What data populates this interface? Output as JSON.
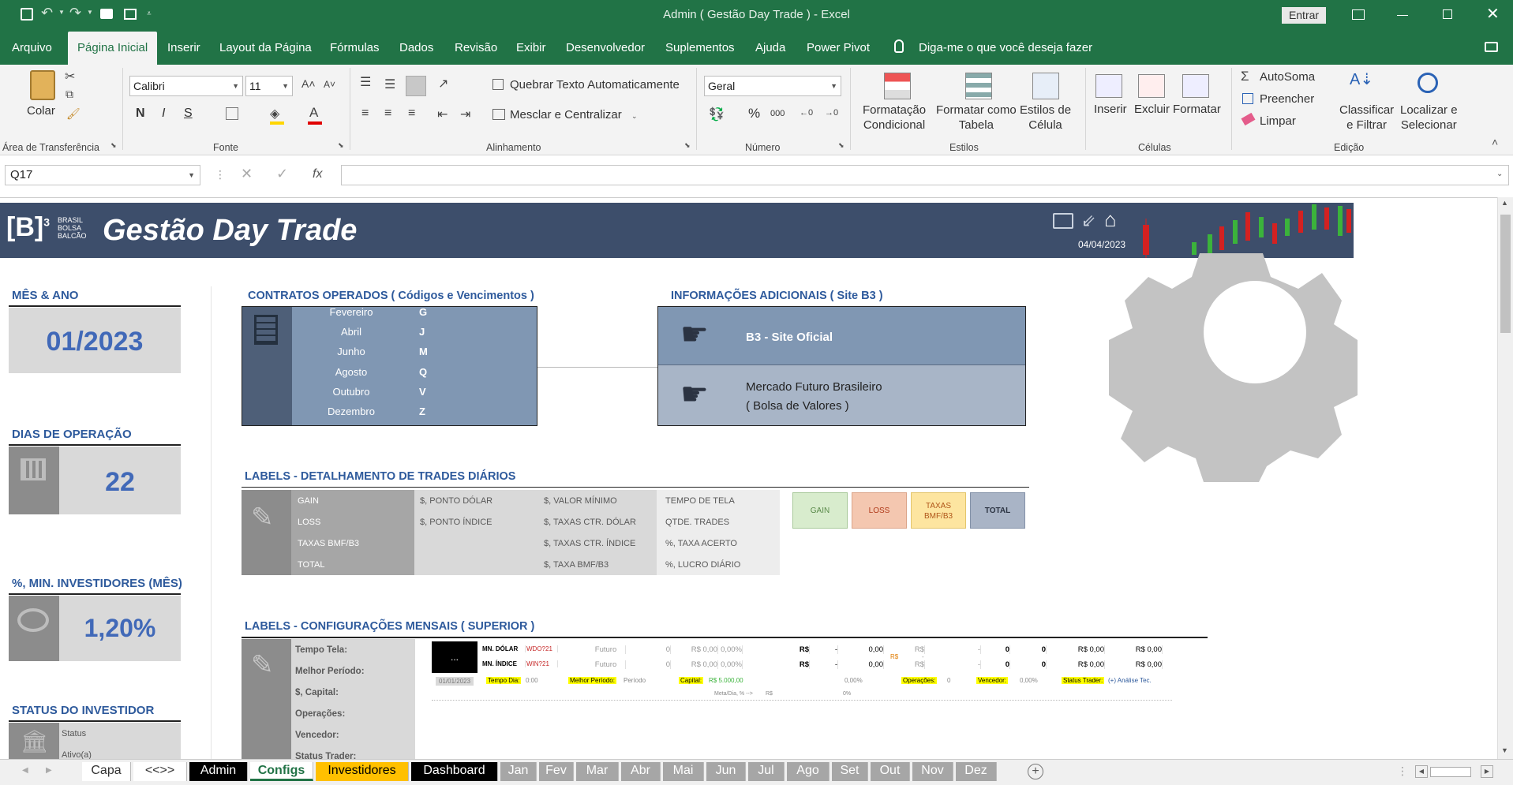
{
  "window": {
    "title": "Admin ( Gestão Day Trade )  -  Excel",
    "signin": "Entrar"
  },
  "menu": [
    "Arquivo",
    "Página Inicial",
    "Inserir",
    "Layout da Página",
    "Fórmulas",
    "Dados",
    "Revisão",
    "Exibir",
    "Desenvolvedor",
    "Suplementos",
    "Ajuda",
    "Power Pivot",
    "Diga-me o que você deseja fazer"
  ],
  "ribbon": {
    "paste": "Colar",
    "clipboard": "Área de Transferência",
    "font_name": "Calibri",
    "font_size": "11",
    "bold": "N",
    "italic": "I",
    "underline": "S",
    "font_group": "Fonte",
    "wrap": "Quebrar Texto Automaticamente",
    "merge": "Mesclar e Centralizar",
    "align_group": "Alinhamento",
    "number_format": "Geral",
    "percent": "%",
    "thousands": "000",
    "number_group": "Número",
    "cond_fmt_1": "Formatação",
    "cond_fmt_2": "Condicional",
    "fmt_table_1": "Formatar como",
    "fmt_table_2": "Tabela",
    "cell_styles_1": "Estilos de",
    "cell_styles_2": "Célula",
    "styles_group": "Estilos",
    "insert": "Inserir",
    "delete": "Excluir",
    "format": "Formatar",
    "cells_group": "Células",
    "autosum": "AutoSoma",
    "fill": "Preencher",
    "clear": "Limpar",
    "sort_1": "Classificar",
    "sort_2": "e Filtrar",
    "find_1": "Localizar e",
    "find_2": "Selecionar",
    "edit_group": "Edição"
  },
  "formula_bar": {
    "name_box": "Q17",
    "fx": "fx",
    "value": ""
  },
  "banner": {
    "logo_b": "[B]",
    "logo_sup": "3",
    "logo_l1": "BRASIL",
    "logo_l2": "BOLSA",
    "logo_l3": "BALCÃO",
    "title": "Gestão Day Trade",
    "date": "04/04/2023"
  },
  "left": {
    "mes_title": "MÊS & ANO",
    "mes_value": "01/2023",
    "dias_title": "DIAS DE OPERAÇÃO",
    "dias_value": "22",
    "inv_title": "%, MIN. INVESTIDORES (MÊS)",
    "inv_value": "1,20%",
    "status_title": "STATUS DO INVESTIDOR",
    "status_l1": "Status",
    "status_l2": "Ativo(a)"
  },
  "contratos": {
    "title": "CONTRATOS OPERADOS ( Códigos e Vencimentos )",
    "rows": [
      [
        "Fevereiro",
        "G"
      ],
      [
        "Abril",
        "J"
      ],
      [
        "Junho",
        "M"
      ],
      [
        "Agosto",
        "Q"
      ],
      [
        "Outubro",
        "V"
      ],
      [
        "Dezembro",
        "Z"
      ]
    ]
  },
  "info": {
    "title": "INFORMAÇÕES ADICIONAIS ( Site B3 )",
    "row1": "B3 - Site Oficial",
    "row2a": "Mercado Futuro Brasileiro",
    "row2b": "( Bolsa de Valores )"
  },
  "labels": {
    "title": "LABELS - DETALHAMENTO DE TRADES DIÁRIOS",
    "col1": [
      "GAIN",
      "LOSS",
      "TAXAS BMF/B3",
      "TOTAL"
    ],
    "col2": [
      "$, PONTO DÓLAR",
      "$, PONTO ÍNDICE"
    ],
    "col3": [
      "$, VALOR MÍNIMO",
      "$, TAXAS CTR. DÓLAR",
      "$, TAXAS CTR. ÍNDICE",
      "$, TAXA  BMF/B3"
    ],
    "col4": [
      "TEMPO DE TELA",
      "QTDE. TRADES",
      "%, TAXA ACERTO",
      "%, LUCRO DIÁRIO"
    ],
    "chip_gain": "GAIN",
    "chip_loss": "LOSS",
    "chip_tax_1": "TAXAS",
    "chip_tax_2": "BMF/B3",
    "chip_total": "TOTAL"
  },
  "config": {
    "title": "LABELS - CONFIGURAÇÕES MENSAIS ( SUPERIOR )",
    "items": [
      "Tempo Tela:",
      "Melhor Período:",
      "$, Capital:",
      "Operações:",
      "Vencedor:",
      "Status Trader:"
    ],
    "dots": "...",
    "row1": [
      "MN. DÓLAR",
      "WDO?21",
      "Futuro",
      "0",
      "R$ 0,00",
      "0,00%",
      "R$",
      "-",
      "0,00",
      "R$",
      "-",
      "0",
      "0",
      "R$ 0,00",
      "R$ 0,00"
    ],
    "row2": [
      "MN. ÍNDICE",
      "WIN?21",
      "Futuro",
      "0",
      "R$ 0,00",
      "0,00%",
      "R$",
      "-",
      "0,00",
      "R$",
      "-",
      "0",
      "0",
      "R$ 0,00",
      "R$ 0,00"
    ],
    "side_rs": "R$",
    "side_dash": "-",
    "row3": [
      "01/01/2023",
      "Tempo Dia:",
      "0:00",
      "Melhor Período:",
      "Período",
      "Capital:",
      "R$ 5.000,00",
      "R$",
      "-",
      "0,00%",
      "Operações:",
      "0",
      "Vencedor:",
      "0,00%",
      "Status Trader:",
      "(+) Análise Tec."
    ],
    "row4": [
      "Meta/Dia, % -->",
      "R$",
      "0%"
    ]
  },
  "tabs": [
    "Capa",
    "<<>>",
    "Admin",
    "Configs",
    "Investidores",
    "Dashboard",
    "Jan",
    "Fev",
    "Mar",
    "Abr",
    "Mai",
    "Jun",
    "Jul",
    "Ago",
    "Set",
    "Out",
    "Nov",
    "Dez"
  ],
  "colors": {
    "excel_green": "#217346",
    "banner": "#3d4e6b",
    "accent_blue": "#4169b8",
    "gain": "#d8eccd",
    "loss": "#f4c7b0",
    "tax": "#fde5a0",
    "total": "#a9b4c6"
  }
}
